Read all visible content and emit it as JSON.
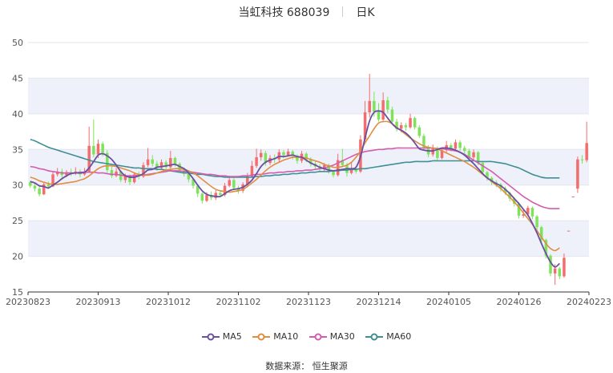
{
  "header": {
    "name": "当虹科技 688039",
    "period": "日K"
  },
  "source": "数据来源： 恒生聚源",
  "colors": {
    "up": "#f26d6d",
    "down": "#7ee35a",
    "MA5": "#6b4fa0",
    "MA10": "#e08e3f",
    "MA30": "#d45cb0",
    "MA60": "#3f8f93",
    "band": "#eef1fa",
    "axis": "#333333"
  },
  "chart_data": {
    "type": "candlestick",
    "xlabels": [
      "20230823",
      "20230913",
      "20231012",
      "20231102",
      "20231123",
      "20231214",
      "20240105",
      "20240126",
      "20240223"
    ],
    "ylim": [
      15,
      50
    ],
    "yticks": [
      15,
      20,
      25,
      30,
      35,
      40,
      45,
      50
    ],
    "grid": true,
    "legend_position": "bottom",
    "dates": [
      "20230823",
      "20230824",
      "20230825",
      "20230828",
      "20230829",
      "20230830",
      "20230831",
      "20230901",
      "20230904",
      "20230905",
      "20230906",
      "20230907",
      "20230908",
      "20230911",
      "20230912",
      "20230913",
      "20230914",
      "20230915",
      "20230918",
      "20230919",
      "20230920",
      "20230921",
      "20230922",
      "20230925",
      "20230926",
      "20230927",
      "20230928",
      "20231009",
      "20231010",
      "20231011",
      "20231012",
      "20231013",
      "20231016",
      "20231017",
      "20231018",
      "20231019",
      "20231020",
      "20231023",
      "20231024",
      "20231025",
      "20231026",
      "20231027",
      "20231030",
      "20231031",
      "20231101",
      "20231102",
      "20231103",
      "20231106",
      "20231107",
      "20231108",
      "20231109",
      "20231110",
      "20231113",
      "20231114",
      "20231115",
      "20231116",
      "20231117",
      "20231120",
      "20231121",
      "20231122",
      "20231123",
      "20231124",
      "20231127",
      "20231128",
      "20231129",
      "20231130",
      "20231201",
      "20231204",
      "20231205",
      "20231206",
      "20231207",
      "20231208",
      "20231211",
      "20231212",
      "20231213",
      "20231214",
      "20231215",
      "20231218",
      "20231219",
      "20231220",
      "20231221",
      "20231222",
      "20231225",
      "20231226",
      "20231227",
      "20231228",
      "20231229",
      "20240102",
      "20240103",
      "20240104",
      "20240105",
      "20240108",
      "20240109",
      "20240110",
      "20240111",
      "20240112",
      "20240115",
      "20240116",
      "20240117",
      "20240118",
      "20240119",
      "20240122",
      "20240123",
      "20240124",
      "20240125",
      "20240126",
      "20240129",
      "20240130",
      "20240131",
      "20240201",
      "20240202",
      "20240205",
      "20240206",
      "20240207",
      "20240208",
      "20240219",
      "20240220",
      "20240221",
      "20240222",
      "20240223"
    ],
    "candles": [
      [
        30.4,
        29.9,
        30.6,
        29.6
      ],
      [
        29.9,
        29.5,
        30.2,
        29.1
      ],
      [
        29.5,
        28.7,
        29.8,
        28.4
      ],
      [
        28.7,
        30.1,
        30.3,
        28.6
      ],
      [
        30.1,
        29.8,
        30.5,
        29.4
      ],
      [
        29.8,
        31.5,
        31.9,
        29.7
      ],
      [
        31.5,
        31.9,
        32.4,
        31.2
      ],
      [
        31.9,
        31.4,
        32.3,
        31.0
      ],
      [
        31.4,
        31.8,
        32.1,
        31.1
      ],
      [
        31.8,
        31.6,
        32.3,
        31.3
      ],
      [
        31.6,
        31.9,
        32.5,
        31.4
      ],
      [
        31.9,
        31.5,
        32.2,
        31.1
      ],
      [
        31.5,
        31.9,
        32.4,
        31.3
      ],
      [
        31.9,
        35.5,
        38.2,
        31.8
      ],
      [
        35.5,
        34.3,
        39.2,
        33.9
      ],
      [
        34.3,
        35.8,
        36.4,
        33.8
      ],
      [
        35.8,
        34.5,
        36.1,
        34.0
      ],
      [
        34.5,
        32.1,
        34.9,
        31.7
      ],
      [
        32.1,
        31.3,
        32.6,
        31.0
      ],
      [
        31.3,
        31.9,
        32.4,
        31.1
      ],
      [
        31.9,
        30.7,
        32.1,
        30.4
      ],
      [
        30.7,
        31.3,
        31.6,
        30.3
      ],
      [
        31.3,
        30.4,
        31.5,
        30.0
      ],
      [
        30.4,
        31.5,
        31.8,
        30.2
      ],
      [
        31.5,
        31.2,
        31.9,
        30.8
      ],
      [
        31.2,
        32.8,
        33.2,
        31.0
      ],
      [
        32.8,
        33.6,
        35.2,
        32.5
      ],
      [
        33.6,
        33.0,
        34.2,
        32.6
      ],
      [
        33.0,
        32.4,
        33.4,
        32.0
      ],
      [
        32.4,
        33.2,
        33.6,
        32.1
      ],
      [
        33.2,
        32.5,
        33.5,
        32.0
      ],
      [
        32.5,
        33.8,
        34.8,
        32.3
      ],
      [
        33.8,
        33.0,
        34.0,
        32.6
      ],
      [
        33.0,
        32.1,
        33.2,
        31.7
      ],
      [
        32.1,
        31.6,
        32.4,
        31.2
      ],
      [
        31.6,
        30.8,
        31.9,
        30.4
      ],
      [
        30.8,
        29.9,
        31.0,
        29.5
      ],
      [
        29.9,
        28.8,
        30.1,
        28.3
      ],
      [
        28.8,
        27.8,
        29.0,
        27.4
      ],
      [
        27.8,
        28.6,
        29.0,
        27.6
      ],
      [
        28.6,
        28.2,
        29.1,
        27.9
      ],
      [
        28.2,
        28.9,
        29.3,
        27.9
      ],
      [
        28.9,
        28.6,
        29.2,
        28.3
      ],
      [
        28.6,
        29.9,
        30.3,
        28.4
      ],
      [
        29.9,
        30.7,
        31.3,
        29.7
      ],
      [
        30.7,
        29.6,
        31.0,
        29.3
      ],
      [
        29.6,
        29.2,
        29.9,
        28.8
      ],
      [
        29.2,
        30.1,
        30.4,
        28.9
      ],
      [
        30.1,
        31.2,
        31.7,
        29.9
      ],
      [
        31.2,
        32.7,
        33.4,
        31.0
      ],
      [
        32.7,
        33.9,
        35.1,
        32.4
      ],
      [
        33.9,
        34.5,
        35.0,
        33.4
      ],
      [
        34.5,
        33.1,
        34.8,
        32.7
      ],
      [
        33.1,
        33.8,
        34.2,
        32.8
      ],
      [
        33.8,
        33.6,
        34.3,
        33.1
      ],
      [
        33.6,
        34.6,
        35.0,
        33.3
      ],
      [
        34.6,
        34.2,
        34.9,
        33.8
      ],
      [
        34.2,
        34.7,
        35.1,
        34.0
      ],
      [
        34.7,
        34.1,
        34.9,
        33.6
      ],
      [
        34.1,
        33.4,
        34.3,
        33.0
      ],
      [
        33.4,
        34.4,
        34.8,
        33.1
      ],
      [
        34.4,
        33.6,
        34.6,
        33.2
      ],
      [
        33.6,
        33.0,
        33.9,
        32.6
      ],
      [
        33.0,
        32.6,
        33.3,
        32.2
      ],
      [
        32.6,
        32.2,
        32.9,
        31.8
      ],
      [
        32.2,
        32.8,
        33.1,
        31.9
      ],
      [
        32.8,
        31.9,
        33.0,
        31.6
      ],
      [
        31.9,
        31.4,
        32.1,
        31.1
      ],
      [
        31.4,
        33.5,
        34.4,
        31.2
      ],
      [
        33.5,
        32.8,
        35.1,
        32.5
      ],
      [
        32.8,
        31.7,
        33.1,
        31.2
      ],
      [
        31.7,
        32.3,
        33.3,
        31.5
      ],
      [
        32.3,
        31.9,
        32.6,
        31.6
      ],
      [
        31.9,
        36.4,
        37.0,
        31.7
      ],
      [
        36.4,
        40.2,
        41.8,
        36.1
      ],
      [
        40.2,
        41.8,
        45.6,
        39.5
      ],
      [
        41.8,
        40.3,
        43.1,
        39.6
      ],
      [
        40.3,
        39.2,
        41.5,
        38.9
      ],
      [
        39.2,
        41.9,
        43.0,
        39.0
      ],
      [
        41.9,
        40.6,
        42.4,
        40.1
      ],
      [
        40.6,
        38.9,
        41.0,
        38.5
      ],
      [
        38.9,
        37.9,
        39.3,
        37.5
      ],
      [
        37.9,
        38.4,
        38.8,
        37.4
      ],
      [
        38.4,
        38.1,
        38.7,
        37.6
      ],
      [
        38.1,
        39.4,
        40.0,
        37.9
      ],
      [
        39.4,
        38.1,
        39.6,
        37.8
      ],
      [
        38.1,
        36.9,
        38.4,
        36.6
      ],
      [
        36.9,
        35.3,
        37.2,
        34.9
      ],
      [
        35.3,
        34.3,
        35.6,
        33.9
      ],
      [
        34.3,
        35.2,
        35.7,
        34.0
      ],
      [
        35.2,
        33.8,
        35.4,
        33.5
      ],
      [
        33.8,
        34.9,
        35.3,
        33.6
      ],
      [
        34.9,
        35.6,
        36.2,
        34.6
      ],
      [
        35.6,
        35.1,
        35.9,
        34.7
      ],
      [
        35.1,
        36.0,
        36.4,
        34.9
      ],
      [
        36.0,
        35.2,
        36.3,
        34.8
      ],
      [
        35.2,
        34.8,
        35.5,
        34.4
      ],
      [
        34.8,
        33.9,
        35.1,
        33.5
      ],
      [
        33.9,
        34.6,
        35.0,
        33.6
      ],
      [
        34.6,
        33.1,
        34.8,
        32.8
      ],
      [
        33.1,
        31.8,
        33.3,
        31.4
      ],
      [
        31.8,
        31.0,
        32.0,
        30.6
      ],
      [
        31.0,
        30.4,
        31.2,
        30.0
      ],
      [
        30.4,
        30.1,
        30.7,
        29.7
      ],
      [
        30.1,
        29.5,
        30.3,
        29.1
      ],
      [
        29.5,
        28.9,
        29.8,
        28.6
      ],
      [
        28.9,
        28.1,
        29.1,
        27.7
      ],
      [
        28.1,
        27.4,
        28.3,
        27.0
      ],
      [
        27.4,
        25.7,
        27.6,
        25.3
      ],
      [
        25.7,
        25.9,
        26.5,
        25.4
      ],
      [
        25.9,
        26.8,
        27.1,
        25.6
      ],
      [
        26.8,
        25.6,
        27.0,
        25.2
      ],
      [
        25.6,
        24.1,
        25.8,
        23.7
      ],
      [
        24.1,
        22.3,
        24.3,
        21.9
      ],
      [
        22.3,
        20.1,
        22.5,
        19.7
      ],
      [
        20.1,
        17.6,
        20.3,
        17.2
      ],
      [
        17.6,
        18.3,
        18.9,
        16.0
      ],
      [
        18.3,
        17.2,
        18.5,
        16.8
      ],
      [
        17.2,
        19.8,
        20.4,
        17.0
      ]
    ],
    "tail": [
      [
        23.6,
        23.6,
        23.6,
        23.6
      ],
      [
        28.4,
        28.4,
        28.4,
        28.4
      ],
      [
        29.5,
        33.6,
        34.0,
        28.9
      ],
      [
        33.6,
        33.5,
        34.2,
        33.0
      ],
      [
        33.5,
        35.9,
        38.9,
        33.2
      ]
    ],
    "ma": {
      "MA5": [
        30.5,
        30.3,
        29.9,
        29.8,
        29.6,
        30.0,
        30.4,
        30.9,
        31.3,
        31.6,
        31.7,
        31.7,
        31.8,
        32.4,
        33.3,
        34.2,
        34.4,
        34.1,
        33.6,
        32.8,
        31.9,
        31.3,
        31.1,
        31.1,
        31.3,
        31.6,
        32.1,
        32.2,
        32.5,
        32.6,
        32.7,
        32.8,
        32.9,
        32.6,
        32.3,
        31.7,
        30.9,
        30.0,
        29.2,
        28.7,
        28.5,
        28.4,
        28.4,
        28.8,
        29.2,
        29.4,
        29.5,
        29.7,
        30.1,
        30.7,
        31.6,
        32.6,
        33.2,
        33.5,
        33.7,
        34.0,
        34.0,
        34.1,
        34.2,
        34.0,
        33.9,
        33.5,
        33.1,
        32.8,
        32.5,
        32.3,
        32.1,
        32.0,
        32.1,
        32.2,
        32.3,
        32.3,
        32.5,
        34.0,
        36.6,
        39.0,
        40.2,
        40.4,
        40.2,
        39.4,
        38.6,
        38.0,
        37.7,
        37.3,
        36.7,
        35.9,
        35.1,
        34.9,
        34.8,
        34.8,
        35.0,
        35.2,
        35.2,
        35.1,
        34.9,
        34.6,
        34.2,
        33.6,
        33.0,
        32.3,
        31.6,
        31.0,
        30.6,
        30.2,
        29.9,
        29.4,
        28.8,
        28.1,
        27.4,
        26.6,
        25.8,
        24.6,
        23.3,
        21.8,
        20.4,
        19.2,
        18.5,
        19.0
      ],
      "MA10": [
        31.1,
        30.9,
        30.6,
        30.4,
        30.2,
        30.1,
        30.1,
        30.2,
        30.3,
        30.4,
        30.5,
        30.7,
        30.9,
        31.3,
        31.8,
        32.3,
        32.6,
        32.7,
        32.7,
        32.6,
        32.4,
        32.2,
        32.0,
        31.7,
        31.5,
        31.4,
        31.4,
        31.5,
        31.7,
        31.9,
        32.1,
        32.2,
        32.3,
        32.3,
        32.2,
        32.0,
        31.7,
        31.3,
        30.8,
        30.3,
        29.8,
        29.4,
        29.2,
        29.1,
        29.0,
        29.1,
        29.2,
        29.4,
        29.8,
        30.3,
        30.8,
        31.4,
        32.0,
        32.5,
        32.9,
        33.2,
        33.5,
        33.7,
        33.9,
        33.9,
        33.9,
        33.8,
        33.6,
        33.4,
        33.2,
        32.9,
        32.7,
        32.5,
        32.5,
        32.6,
        32.8,
        33.2,
        33.9,
        34.8,
        35.9,
        36.9,
        37.9,
        38.7,
        38.9,
        38.9,
        38.6,
        38.1,
        37.6,
        37.1,
        36.6,
        36.2,
        35.8,
        35.5,
        35.3,
        35.2,
        35.1,
        34.8,
        34.5,
        34.2,
        33.9,
        33.6,
        33.3,
        32.9,
        32.5,
        32.0,
        31.5,
        31.0,
        30.5,
        30.0,
        29.5,
        28.9,
        28.3,
        27.6,
        26.9,
        26.1,
        25.3,
        24.5,
        23.6,
        22.7,
        21.8,
        21.1,
        20.8,
        21.2
      ],
      "MA30": [
        32.6,
        32.5,
        32.3,
        32.2,
        32.0,
        31.9,
        31.8,
        31.7,
        31.7,
        31.7,
        31.7,
        31.8,
        31.8,
        31.8,
        31.8,
        31.7,
        31.7,
        31.6,
        31.5,
        31.5,
        31.4,
        31.3,
        31.3,
        31.3,
        31.4,
        31.4,
        31.5,
        31.6,
        31.7,
        31.8,
        31.9,
        32.0,
        32.0,
        32.0,
        31.9,
        31.9,
        31.8,
        31.7,
        31.6,
        31.5,
        31.5,
        31.4,
        31.3,
        31.3,
        31.2,
        31.2,
        31.2,
        31.3,
        31.3,
        31.4,
        31.5,
        31.5,
        31.6,
        31.7,
        31.7,
        31.8,
        31.8,
        31.9,
        31.9,
        32.0,
        32.0,
        32.1,
        32.1,
        32.2,
        32.3,
        32.4,
        32.6,
        32.8,
        33.1,
        33.4,
        33.7,
        34.0,
        34.3,
        34.5,
        34.7,
        34.8,
        34.9,
        35.0,
        35.0,
        35.1,
        35.1,
        35.2,
        35.2,
        35.2,
        35.2,
        35.2,
        35.2,
        35.2,
        35.2,
        35.2,
        35.1,
        35.1,
        35.0,
        34.9,
        34.8,
        34.6,
        34.3,
        33.9,
        33.5,
        33.1,
        32.7,
        32.3,
        31.9,
        31.4,
        30.9,
        30.4,
        29.9,
        29.4,
        28.9,
        28.4,
        28.0,
        27.6,
        27.3,
        27.0,
        26.8,
        26.7,
        26.7,
        26.7
      ],
      "MA60": [
        36.4,
        36.2,
        35.9,
        35.6,
        35.3,
        35.1,
        34.9,
        34.7,
        34.5,
        34.3,
        34.1,
        33.9,
        33.7,
        33.5,
        33.3,
        33.2,
        33.1,
        33.0,
        32.9,
        32.8,
        32.7,
        32.6,
        32.5,
        32.4,
        32.4,
        32.3,
        32.3,
        32.3,
        32.2,
        32.2,
        32.1,
        32.0,
        31.9,
        31.8,
        31.7,
        31.7,
        31.6,
        31.5,
        31.5,
        31.4,
        31.3,
        31.2,
        31.2,
        31.1,
        31.1,
        31.1,
        31.1,
        31.1,
        31.1,
        31.1,
        31.2,
        31.2,
        31.3,
        31.3,
        31.4,
        31.4,
        31.5,
        31.5,
        31.6,
        31.6,
        31.7,
        31.7,
        31.8,
        31.8,
        31.9,
        31.9,
        31.9,
        32.0,
        32.0,
        32.1,
        32.1,
        32.2,
        32.2,
        32.3,
        32.3,
        32.4,
        32.5,
        32.6,
        32.7,
        32.8,
        32.9,
        33.0,
        33.1,
        33.2,
        33.2,
        33.3,
        33.3,
        33.3,
        33.3,
        33.4,
        33.4,
        33.4,
        33.4,
        33.4,
        33.4,
        33.4,
        33.4,
        33.4,
        33.4,
        33.3,
        33.3,
        33.3,
        33.3,
        33.2,
        33.1,
        33.0,
        32.8,
        32.6,
        32.4,
        32.1,
        31.8,
        31.5,
        31.3,
        31.1,
        31.0,
        31.0,
        31.0,
        31.0
      ]
    },
    "series": [
      {
        "name": "MA5"
      },
      {
        "name": "MA10"
      },
      {
        "name": "MA30"
      },
      {
        "name": "MA60"
      }
    ]
  }
}
